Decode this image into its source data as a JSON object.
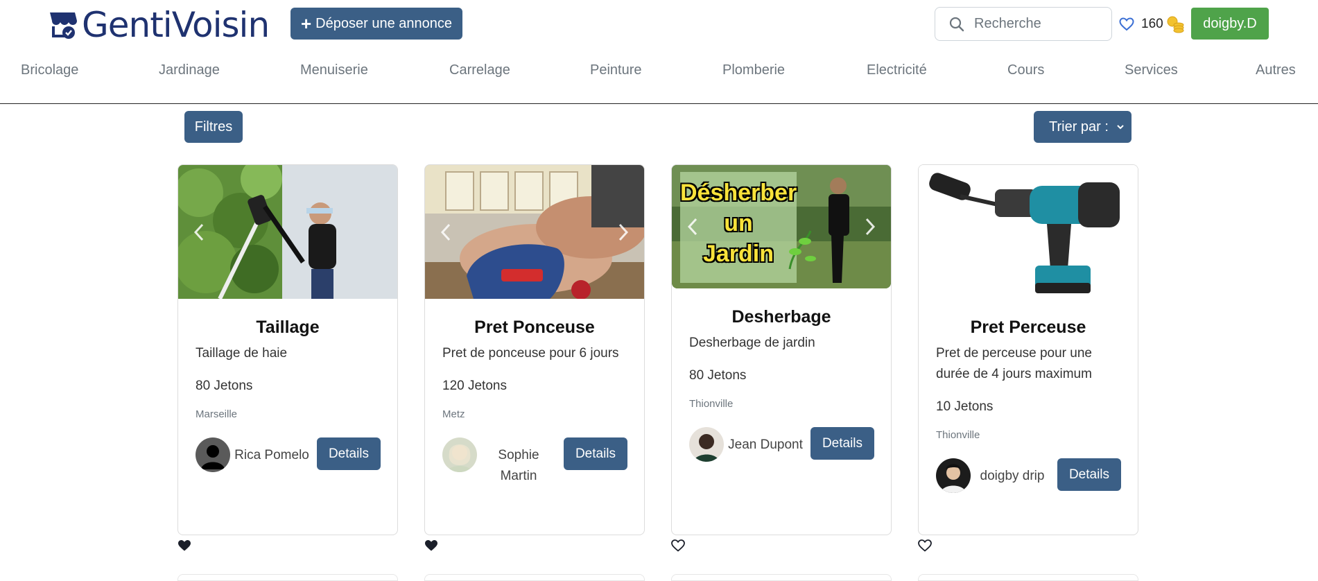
{
  "header": {
    "logo_text": "GentiVoisin",
    "post_button": {
      "plus": "+",
      "label": "Déposer une annonce"
    },
    "search": {
      "placeholder": "Recherche"
    },
    "favorites_count": "160",
    "user_button": "doigby.D"
  },
  "categories": [
    "Bricolage",
    "Jardinage",
    "Menuiserie",
    "Carrelage",
    "Peinture",
    "Plomberie",
    "Electricité",
    "Cours",
    "Services",
    "Autres"
  ],
  "toolbar": {
    "filters_label": "Filtres",
    "sort_label": "Trier par :"
  },
  "listings": [
    {
      "title": "Taillage",
      "description": "Taillage de haie",
      "price": "80 Jetons",
      "city": "Marseille",
      "owner": "Rica Pomelo",
      "details": "Details",
      "favorited": true,
      "image": "hedge-trimming-photo"
    },
    {
      "title": "Pret Ponceuse",
      "description": "Pret de ponceuse pour 6 jours",
      "price": "120 Jetons",
      "city": "Metz",
      "owner": "Sophie Martin",
      "details": "Details",
      "favorited": true,
      "image": "sander-photo"
    },
    {
      "title": "Desherbage",
      "description": "Desherbage de jardin",
      "price": "80 Jetons",
      "city": "Thionville",
      "owner": "Jean Dupont",
      "details": "Details",
      "favorited": false,
      "image": "weeding-thumbnail",
      "image_caption": [
        "Désherber",
        "un",
        "Jardin"
      ]
    },
    {
      "title": "Pret Perceuse",
      "description": "Pret de perceuse pour une durée de 4 jours maximum",
      "price": "10 Jetons",
      "city": "Thionville",
      "owner": "doigby drip",
      "details": "Details",
      "favorited": false,
      "image": "makita-drill-photo"
    }
  ],
  "colors": {
    "brand": "#1f3270",
    "primary_button": "#3b5f86",
    "user_button": "#4fa34a",
    "muted_text": "#6c757d"
  }
}
